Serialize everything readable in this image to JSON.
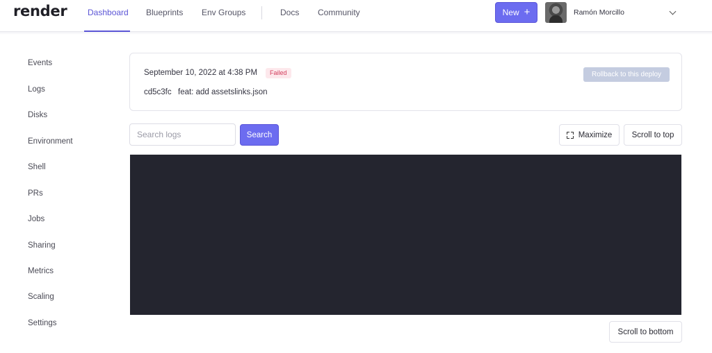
{
  "brand": {
    "logo_text": "render"
  },
  "nav": {
    "links": [
      {
        "label": "Dashboard",
        "active": true
      },
      {
        "label": "Blueprints",
        "active": false
      },
      {
        "label": "Env Groups",
        "active": false
      },
      {
        "label": "Docs",
        "active": false
      },
      {
        "label": "Community",
        "active": false
      }
    ],
    "new_label": "New",
    "new_icon": "plus-icon",
    "user_name": "Ramón Morcillo",
    "user_menu_icon": "chevron-down-icon"
  },
  "sidebar": {
    "items": [
      {
        "label": "Events"
      },
      {
        "label": "Logs"
      },
      {
        "label": "Disks"
      },
      {
        "label": "Environment"
      },
      {
        "label": "Shell"
      },
      {
        "label": "PRs"
      },
      {
        "label": "Jobs"
      },
      {
        "label": "Sharing"
      },
      {
        "label": "Metrics"
      },
      {
        "label": "Scaling"
      },
      {
        "label": "Settings"
      }
    ]
  },
  "deploy": {
    "date": "September 10, 2022 at 4:38 PM",
    "status": "Failed",
    "commit_hash": "cd5c3fc",
    "commit_message": "feat: add assetslinks.json",
    "rollback_label": "Rollback to this deploy"
  },
  "logs": {
    "search_placeholder": "Search logs",
    "search_value": "",
    "search_label": "Search",
    "maximize_label": "Maximize",
    "maximize_icon": "expand-icon",
    "scroll_top_label": "Scroll to top",
    "scroll_bottom_label": "Scroll to bottom"
  },
  "colors": {
    "accent": "#6c6cf0",
    "failed_bg": "#fde8ec",
    "failed_text": "#d23d5c",
    "log_bg": "#24252f"
  }
}
